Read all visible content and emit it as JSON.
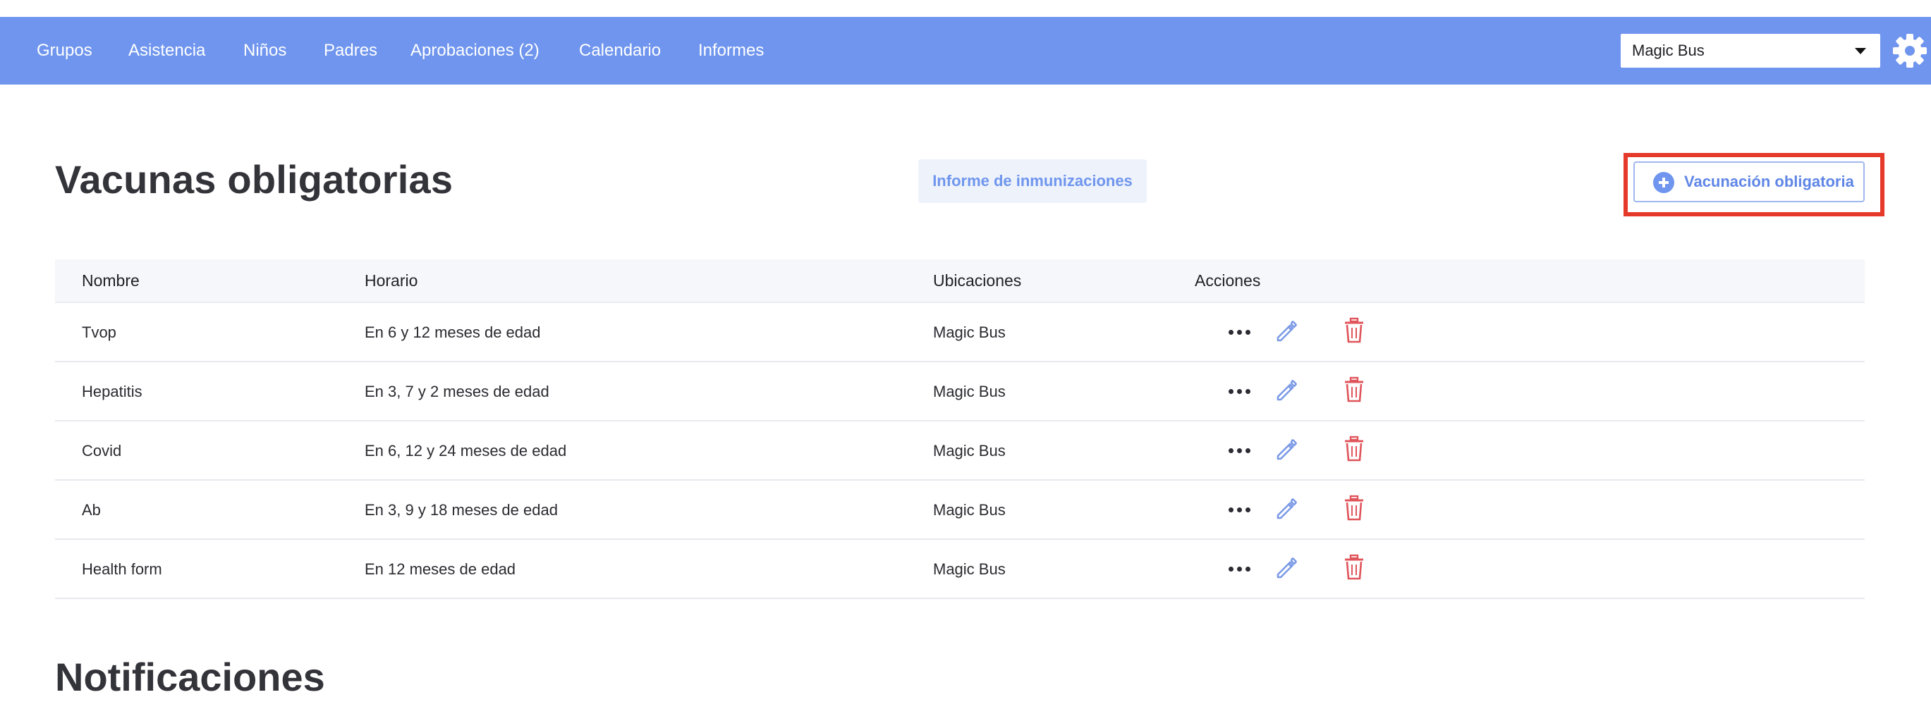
{
  "nav": {
    "items": [
      {
        "label": "Grupos"
      },
      {
        "label": "Asistencia"
      },
      {
        "label": "Niños"
      },
      {
        "label": "Padres"
      },
      {
        "label": "Aprobaciones (2)"
      },
      {
        "label": "Calendario"
      },
      {
        "label": "Informes"
      }
    ],
    "org_select": {
      "value": "Magic Bus"
    },
    "settings_icon": "gear-icon"
  },
  "page": {
    "title": "Vacunas obligatorias",
    "report_button": "Informe de inmunizaciones",
    "add_button": "Vacunación obligatoria",
    "add_icon": "plus-circle-icon"
  },
  "table": {
    "headers": [
      "Nombre",
      "Horario",
      "Ubicaciones",
      "Acciones"
    ],
    "rows": [
      {
        "name": "Tvop",
        "schedule": "En 6 y 12 meses de edad",
        "location": "Magic Bus"
      },
      {
        "name": "Hepatitis",
        "schedule": "En 3, 7 y 2 meses de edad",
        "location": "Magic Bus"
      },
      {
        "name": "Covid",
        "schedule": "En 6, 12 y 24 meses de edad",
        "location": "Magic Bus"
      },
      {
        "name": "Ab",
        "schedule": "En 3, 9 y 18 meses de edad",
        "location": "Magic Bus"
      },
      {
        "name": "Health form",
        "schedule": "En 12 meses de edad",
        "location": "Magic Bus"
      }
    ],
    "action_icons": [
      "more-icon",
      "edit-icon",
      "trash-icon"
    ]
  },
  "notifications": {
    "title": "Notificaciones"
  },
  "colors": {
    "nav_bg": "#6f95ee",
    "accent": "#6f95ee",
    "highlight": "#e5392a",
    "delete": "#e0555b"
  }
}
